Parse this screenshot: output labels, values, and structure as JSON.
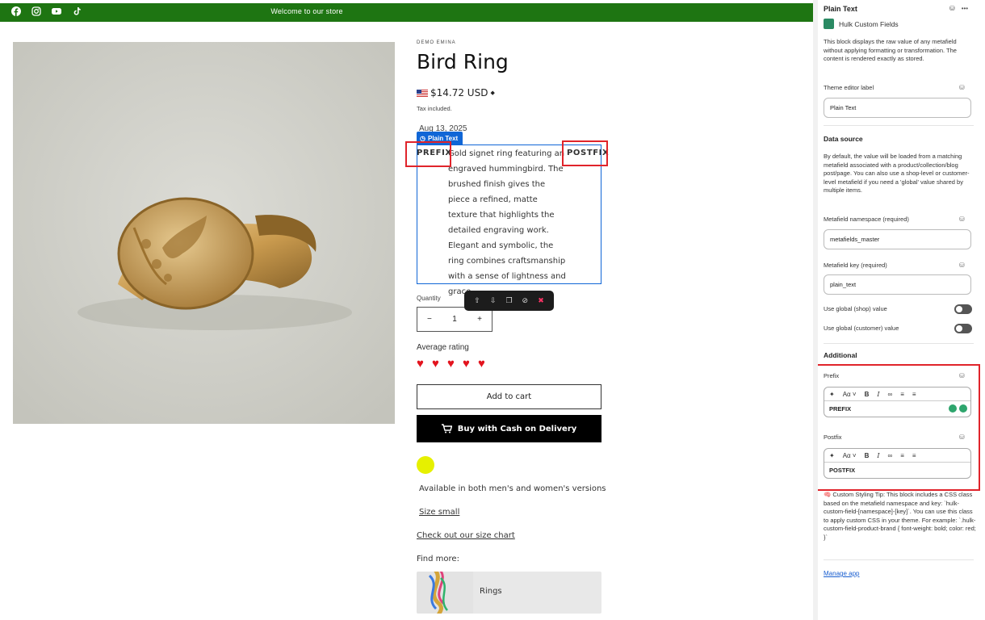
{
  "store": {
    "announcement": "Welcome to our store",
    "social_icons": [
      "facebook-icon",
      "instagram-icon",
      "youtube-icon",
      "tiktok-icon"
    ],
    "vendor": "DEMO EMINA",
    "title": "Bird Ring",
    "price": "$14.72 USD",
    "tax": "Tax included.",
    "date": "Aug 13, 2025",
    "plain_text_badge": "Plain Text",
    "prefix": "PREFIX",
    "postfix": "POSTFIX",
    "description": "Gold signet ring featuring an engraved hummingbird. The brushed finish gives the piece a refined, matte texture that highlights the detailed engraving work. Elegant and symbolic, the ring combines craftsmanship with a sense of lightness and grace.",
    "quantity_label": "Quantity",
    "quantity_value": "1",
    "average_rating_label": "Average rating",
    "rating": 4.5,
    "add_to_cart": "Add to cart",
    "buy_cod": "Buy with Cash on Delivery",
    "availability": "Available in both men's and women's versions",
    "size_small": "Size small",
    "size_chart": "Check out our size chart",
    "find_more": "Find more:",
    "rings_label": "Rings",
    "accent_color": "#1e7512",
    "swatch_color": "#e6f000"
  },
  "panel": {
    "title": "Plain Text",
    "app_name": "Hulk Custom Fields",
    "description": "This block displays the raw value of any metafield without applying formatting or transformation. The content is rendered exactly as stored.",
    "theme_label_title": "Theme editor label",
    "theme_label_value": "Plain Text",
    "data_source_title": "Data source",
    "data_source_desc": "By default, the value will be loaded from a matching metafield associated with a product/collection/blog post/page. You can also use a shop-level or customer-level metafield if you need a 'global' value shared by multiple items.",
    "namespace_label": "Metafield namespace (required)",
    "namespace_value": "metafields_master",
    "key_label": "Metafield key (required)",
    "key_value": "plain_text",
    "global_shop_label": "Use global (shop) value",
    "global_customer_label": "Use global (customer) value",
    "additional_title": "Additional",
    "prefix_label": "Prefix",
    "prefix_value": "PREFIX",
    "postfix_label": "Postfix",
    "postfix_value": "POSTFIX",
    "tip": "🧠 Custom Styling Tip: This block includes a CSS class based on the metafield namespace and key: `hulk-custom-field-[namespace]-[key]`. You can use this class to apply custom CSS in your theme. For example: `.hulk-custom-field-product-brand { font-weight: bold; color: red; }`",
    "manage_app": "Manage app"
  }
}
